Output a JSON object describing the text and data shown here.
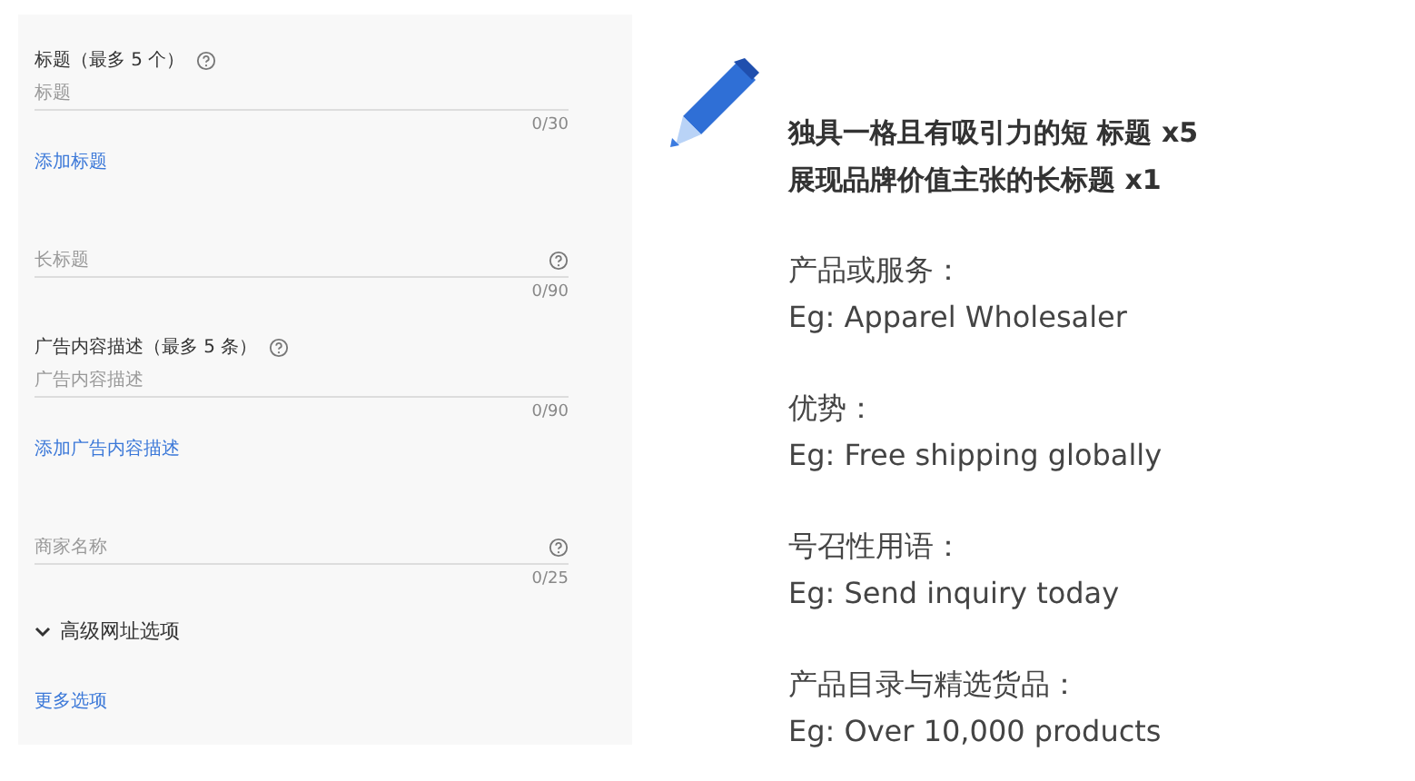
{
  "form": [
    {
      "kind": "heading",
      "text": "标题（最多 5 个）",
      "help": true
    },
    {
      "kind": "field",
      "placeholder": "标题",
      "counter": "0/30",
      "help": false
    },
    {
      "kind": "link",
      "text": "添加标题"
    },
    {
      "kind": "field",
      "placeholder": "长标题",
      "counter": "0/90",
      "help": true
    },
    {
      "kind": "heading",
      "text": "广告内容描述（最多 5 条）",
      "help": true
    },
    {
      "kind": "field",
      "placeholder": "广告内容描述",
      "counter": "0/90",
      "help": false
    },
    {
      "kind": "link",
      "text": "添加广告内容描述"
    },
    {
      "kind": "field",
      "placeholder": "商家名称",
      "counter": "0/25",
      "help": true
    },
    {
      "kind": "expander",
      "text": "高级网址选项",
      "expanded": false
    },
    {
      "kind": "link",
      "text": "更多选项"
    }
  ],
  "notes": {
    "headlines": [
      "独具一格且有吸引力的短 标题 x5",
      "展现品牌价值主张的长标题 x1"
    ],
    "groups": [
      {
        "label": "产品或服务：",
        "example": "Eg: Apparel Wholesaler"
      },
      {
        "label": "优势：",
        "example": "Eg: Free shipping globally"
      },
      {
        "label": "号召性用语：",
        "example": "Eg: Send inquiry today"
      },
      {
        "label": "产品目录与精选货品：",
        "example": "Eg: Over 10,000 products"
      }
    ]
  }
}
